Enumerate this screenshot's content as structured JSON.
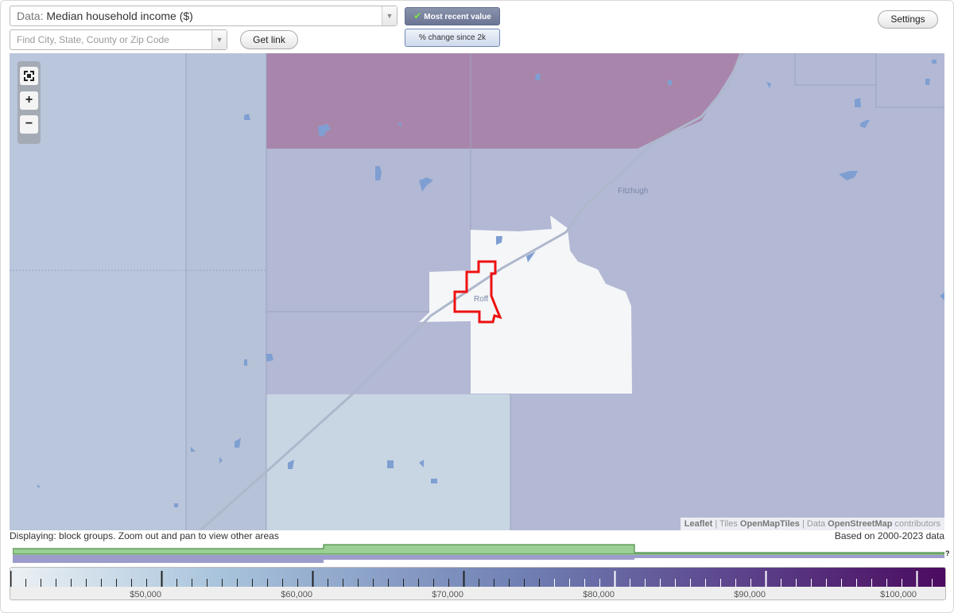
{
  "controls": {
    "data_prefix": "Data:",
    "data_value": "Median household income ($)",
    "search_placeholder": "Find City, State, County or Zip Code",
    "get_link": "Get link",
    "toggle_recent": "Most recent value",
    "toggle_change": "% change since 2k",
    "settings": "Settings"
  },
  "map": {
    "place_labels": [
      "Fitzhugh",
      "Roff"
    ],
    "attribution": {
      "leaflet": "Leaflet",
      "sep1": " | Tiles ",
      "tiles": "OpenMapTiles",
      "sep2": " | Data ",
      "data": "OpenStreetMap",
      "contributors": " contributors"
    },
    "colors": {
      "base": "#b3b9d4",
      "light": "#c8d6e4",
      "dark": "#a886ab",
      "white": "#f4f6f8",
      "highlight": "#ee1111"
    }
  },
  "status": {
    "displaying": "Displaying: block groups. Zoom out and pan to view other areas",
    "based_on": "Based on 2000-2023 data"
  },
  "histogram": {
    "help": "?",
    "green": "#9bcf93",
    "purple": "#9c9ccc"
  },
  "legend": {
    "min": 40000,
    "max": 102000,
    "labels": [
      "$50,000",
      "$60,000",
      "$70,000",
      "$80,000",
      "$90,000",
      "$100,000"
    ],
    "label_values": [
      50000,
      60000,
      70000,
      80000,
      90000,
      100000
    ],
    "gradient": [
      "#ecf1f4",
      "#a9c4dc",
      "#6f7fb3",
      "#5a3e87",
      "#4b0a5e"
    ]
  }
}
